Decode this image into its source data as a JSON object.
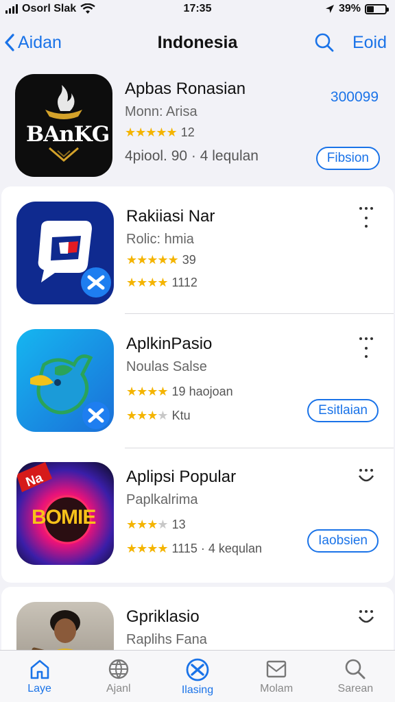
{
  "status_bar": {
    "carrier": "Osorl Slak",
    "time": "17:35",
    "battery": "39%",
    "battery_level": 0.39
  },
  "nav": {
    "back_label": "Aidan",
    "title": "Indonesia",
    "edit_label": "Eoid"
  },
  "apps": [
    {
      "name": "Apbas Ronasian",
      "subtitle": "Monn: Arisa",
      "rating_stars": 5,
      "rating_count": "12",
      "meta": "4piool. 90 · 4 lequlan",
      "price": "300099",
      "action": "Fibsion"
    },
    {
      "name": "Rakiiasi Nar",
      "subtitle": "Rolic: hmia",
      "rating_stars": 5,
      "rating_count": "39",
      "rating2_stars": 4,
      "rating2_count": "1112"
    },
    {
      "name": "AplkinPasio",
      "subtitle": "Noulas Salse",
      "rating_stars": 4,
      "rating_count": "19 haojoan",
      "rating2_stars": 3,
      "rating2_count": "Ktu",
      "action": "Esitlaian"
    },
    {
      "name": "Aplipsi Popular",
      "subtitle": "Paplkalrima",
      "rating_stars": 3.5,
      "rating_count": "13",
      "rating2_stars": 4,
      "rating2_count": "1115 · 4 kequlan",
      "action": "Iaobsien"
    },
    {
      "name": "Gpriklasio",
      "subtitle": "Raplihs Fana"
    }
  ],
  "icon_text": {
    "bank": "BAnKG",
    "bomb": "BOMIE",
    "new": "Na"
  },
  "tabs": [
    {
      "label": "Laye",
      "icon": "home-icon"
    },
    {
      "label": "Ajanl",
      "icon": "globe-icon"
    },
    {
      "label": "Ilasing",
      "icon": "circle-x-icon"
    },
    {
      "label": "Molam",
      "icon": "image-icon"
    },
    {
      "label": "Sarean",
      "icon": "search-icon"
    }
  ],
  "colors": {
    "accent": "#1a73e8",
    "star": "#f4b400"
  }
}
